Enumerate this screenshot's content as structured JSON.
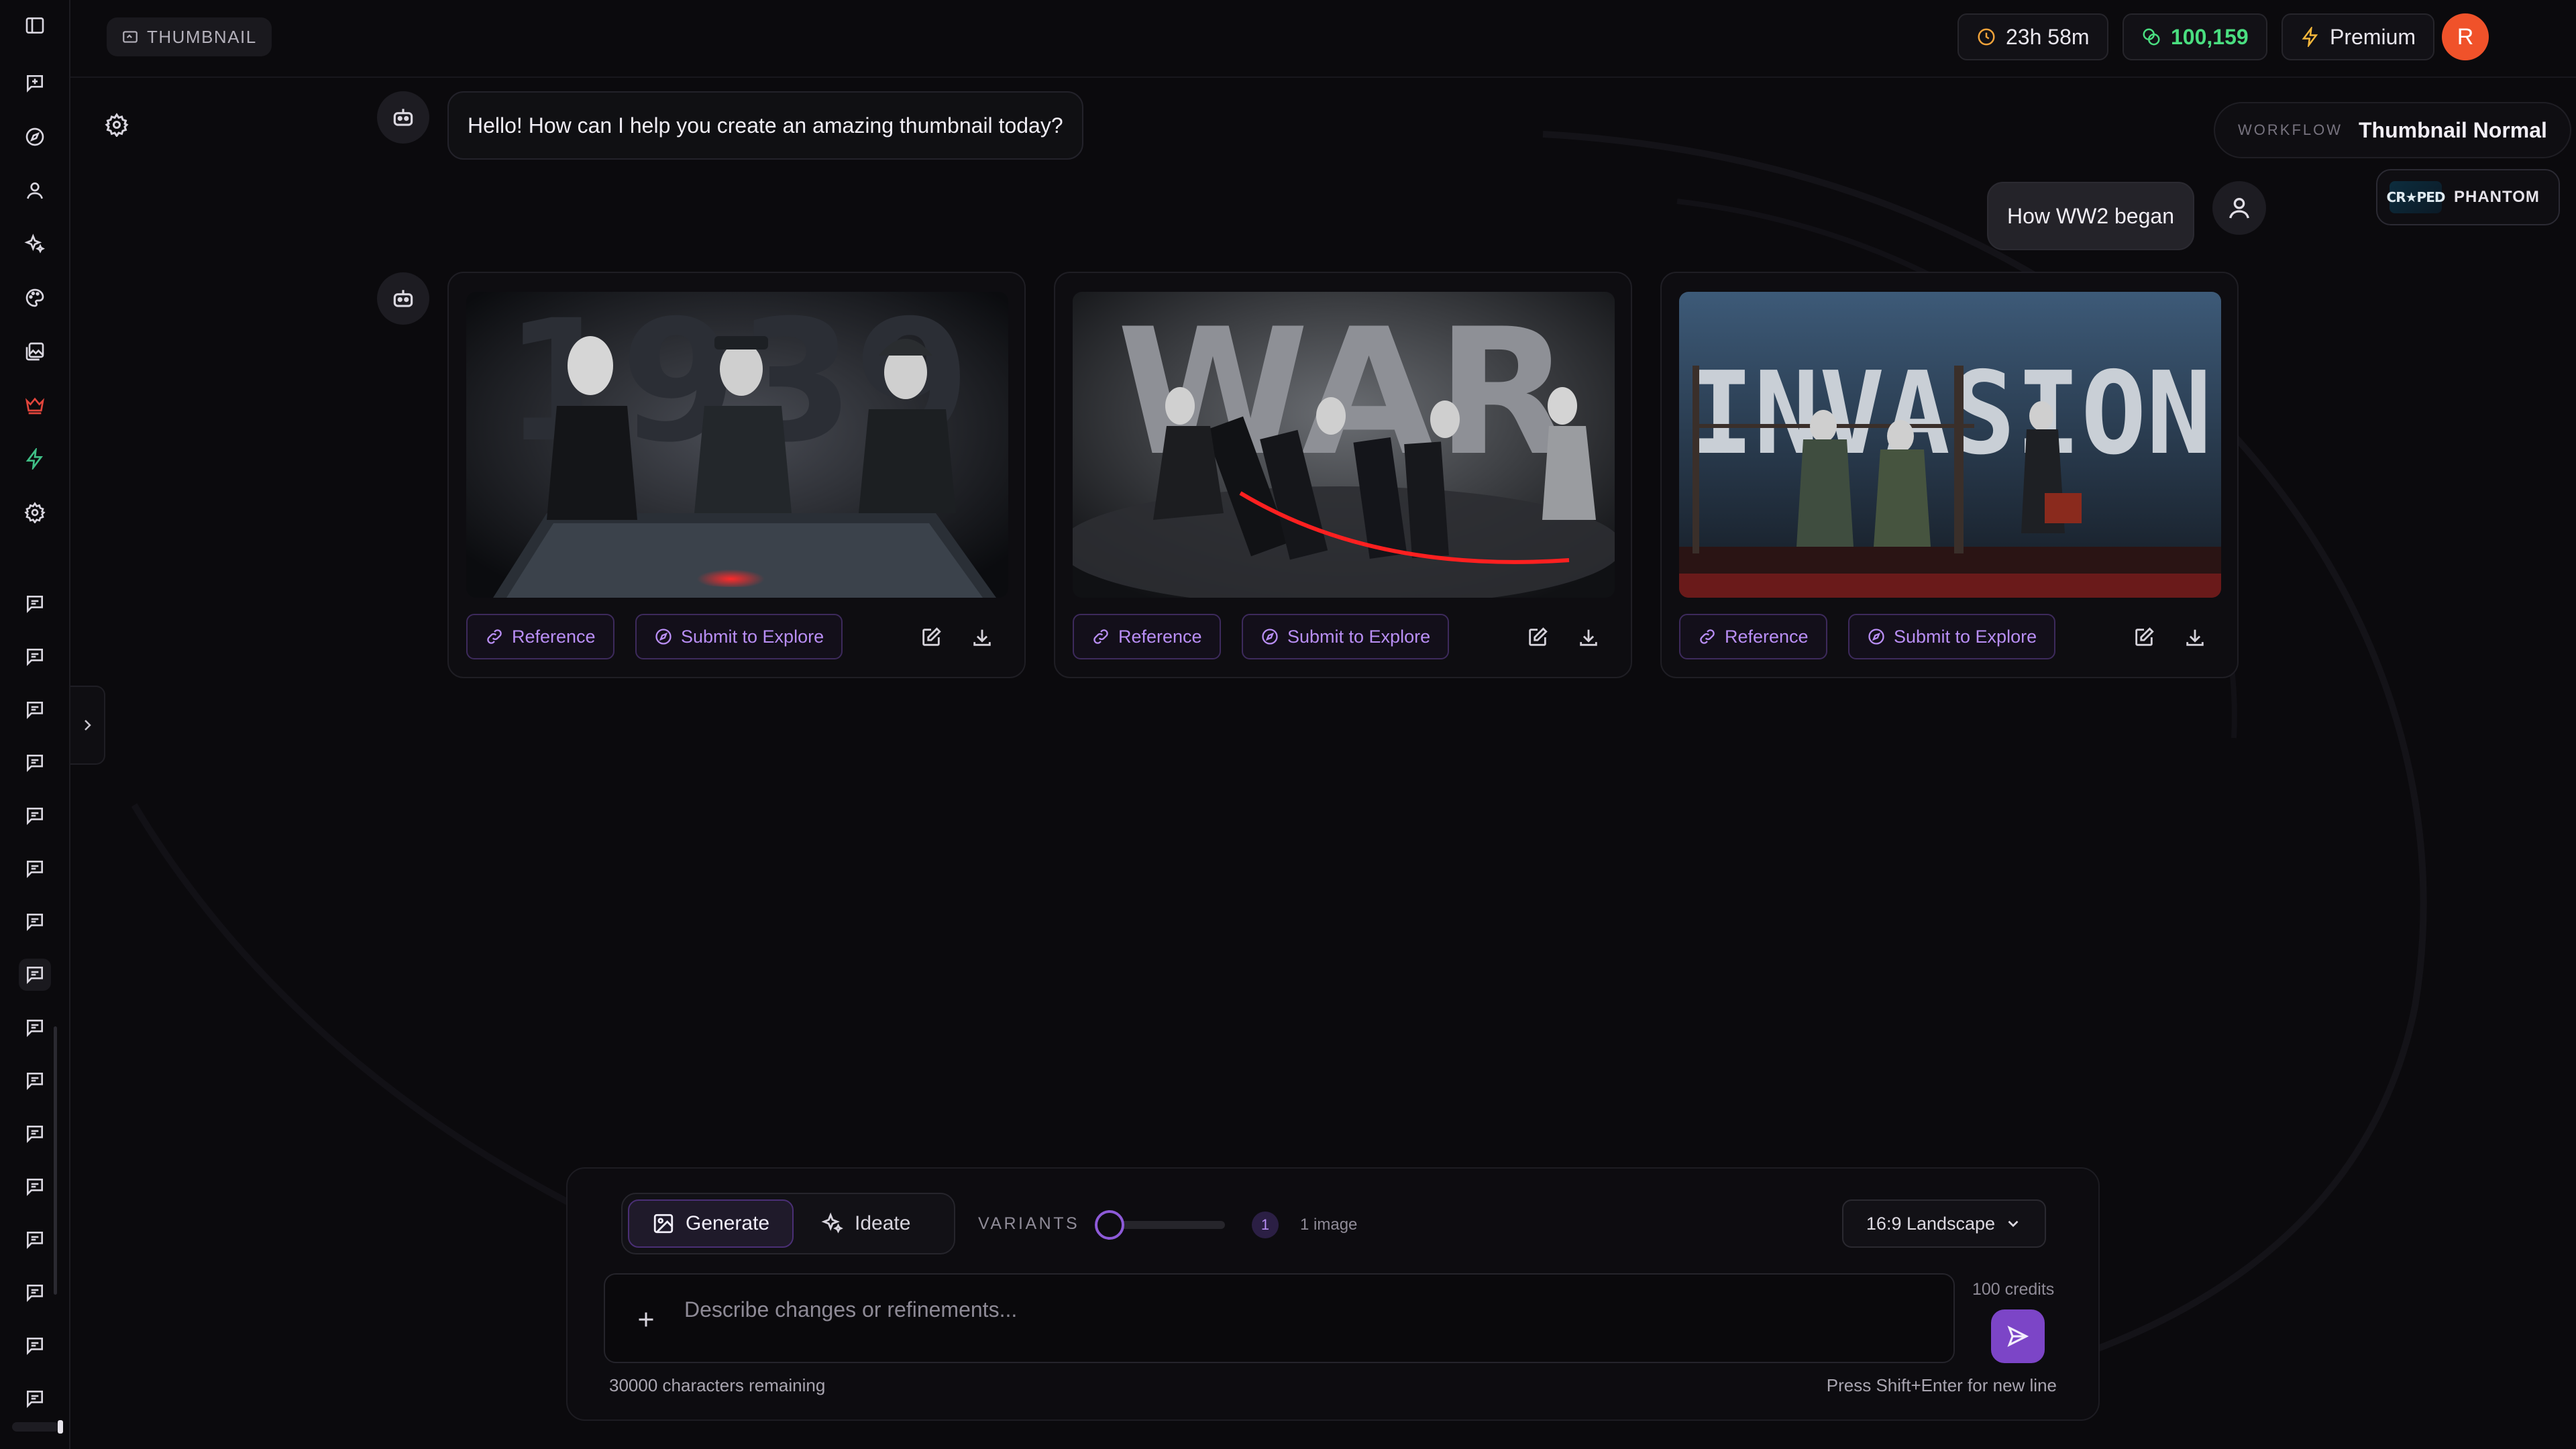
{
  "topbar": {
    "section_label": "THUMBNAIL",
    "timer": "23h 58m",
    "credits": "100,159",
    "plan": "Premium",
    "avatar_initial": "R"
  },
  "workflow": {
    "label": "WORKFLOW",
    "name": "Thumbnail Normal"
  },
  "channel": {
    "logo_text": "CR★PED",
    "name": "PHANTOM"
  },
  "messages": {
    "bot_greeting": "Hello! How can I help you create an amazing thumbnail today?",
    "user_prompt": "How WW2 began"
  },
  "results": [
    {
      "title_text": "1939",
      "reference_label": "Reference",
      "submit_label": "Submit to Explore"
    },
    {
      "title_text": "WAR",
      "reference_label": "Reference",
      "submit_label": "Submit to Explore"
    },
    {
      "title_text": "INVASION",
      "reference_label": "Reference",
      "submit_label": "Submit to Explore"
    }
  ],
  "composer": {
    "generate_label": "Generate",
    "ideate_label": "Ideate",
    "variants_label": "VARIANTS",
    "variant_count": "1",
    "variant_text": "1 image",
    "aspect_ratio": "16:9 Landscape",
    "placeholder": "Describe changes or refinements...",
    "credit_cost": "100 credits",
    "chars_remaining": "30000 characters remaining",
    "hint": "Press Shift+Enter for new line"
  },
  "colors": {
    "accent": "#7c45c7",
    "credits_green": "#4ade80",
    "timer_orange": "#f2a33a",
    "avatar_orange": "#f0522a"
  }
}
